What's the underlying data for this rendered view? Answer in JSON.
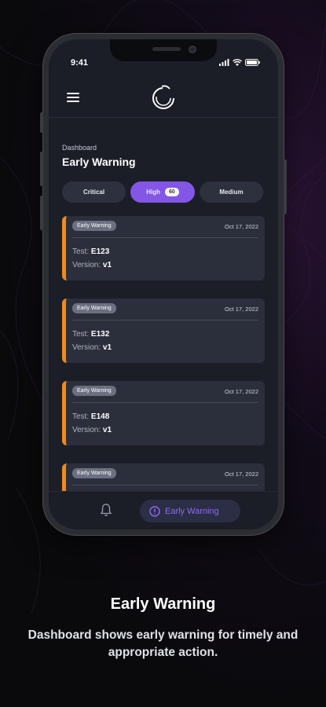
{
  "status": {
    "time": "9:41"
  },
  "header": {
    "menu_icon": "hamburger-icon",
    "logo_icon": "ring-logo-icon"
  },
  "page": {
    "breadcrumb": "Dashboard",
    "title": "Early Warning"
  },
  "filters": [
    {
      "label": "Critical",
      "active": false
    },
    {
      "label": "High",
      "count": "60",
      "active": true
    },
    {
      "label": "Medium",
      "active": false
    }
  ],
  "cards": [
    {
      "badge": "Early Warning",
      "date": "Oct 17, 2022",
      "test_label": "Test:",
      "test_value": "E123",
      "version_label": "Version:",
      "version_value": "v1"
    },
    {
      "badge": "Early Warning",
      "date": "Oct 17, 2022",
      "test_label": "Test:",
      "test_value": "E132",
      "version_label": "Version:",
      "version_value": "v1"
    },
    {
      "badge": "Early Warning",
      "date": "Oct 17, 2022",
      "test_label": "Test:",
      "test_value": "E148",
      "version_label": "Version:",
      "version_value": "v1"
    },
    {
      "badge": "Early Warning",
      "date": "Oct 17, 2022"
    }
  ],
  "bottom_nav": {
    "bell_icon": "bell-icon",
    "active_label": "Early Warning",
    "active_icon": "alert-circle-icon"
  },
  "promo": {
    "headline": "Early Warning",
    "subtext": "Dashboard shows early warning for timely and appropriate action."
  },
  "colors": {
    "accent": "#8456e6",
    "warning_border": "#f08a1c",
    "card_bg": "#2b2f3b",
    "screen_bg": "#1b1e27"
  }
}
